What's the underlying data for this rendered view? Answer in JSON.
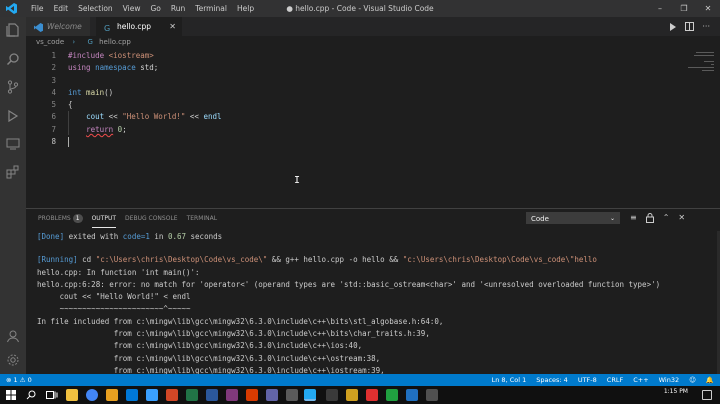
{
  "window": {
    "title": "● hello.cpp - Code - Visual Studio Code",
    "min": "–",
    "max": "❐",
    "close": "✕"
  },
  "menu": [
    "File",
    "Edit",
    "Selection",
    "View",
    "Go",
    "Run",
    "Terminal",
    "Help"
  ],
  "tabs": [
    {
      "label": "Welcome"
    },
    {
      "label": "hello.cpp",
      "close": "✕"
    }
  ],
  "breadcrumb": {
    "folder": "vs_code",
    "sep": "›",
    "icon": "C++ file-icon",
    "file": "hello.cpp"
  },
  "editor": {
    "line_numbers": [
      "1",
      "2",
      "3",
      "4",
      "5",
      "6",
      "7",
      "8"
    ],
    "code": {
      "l1_kw": "#include",
      "l1_hdr": " <iostream>",
      "l2_using": "using",
      "l2_ns": " namespace",
      "l2_std": " std;",
      "l4_int": "int",
      "l4_main": " main",
      "l4_paren": "()",
      "l5": "{",
      "l6_cout": "cout",
      "l6_op": " << ",
      "l6_str": "\"Hello World!\"",
      "l6_op2": " << ",
      "l6_endl": "endl",
      "l7_return": "return",
      "l7_num": " 0",
      "l7_semi": ";"
    },
    "current_line": "8"
  },
  "panel": {
    "tabs": {
      "problems": "PROBLEMS",
      "problems_count": "1",
      "output": "OUTPUT",
      "debug": "DEBUG CONSOLE",
      "terminal": "TERMINAL"
    },
    "channel": "Code",
    "output_lines": {
      "done_tag": "[Done]",
      "done_a": " exited with ",
      "done_code": "code=1",
      "done_b": " in ",
      "done_time": "0.67",
      "done_c": " seconds",
      "run_tag": "[Running]",
      "run_cmd_a": " cd ",
      "run_path1": "\"c:\\Users\\chris\\Desktop\\Code\\vs_code\\\"",
      "run_cmd_b": " && g++ hello.cpp -o hello && ",
      "run_path2": "\"c:\\Users\\chris\\Desktop\\Code\\vs_code\\\"hello",
      "l3": "hello.cpp: In function 'int main()':",
      "l4": "hello.cpp:6:28: error: no match for 'operator<' (operand types are 'std::basic_ostream<char>' and '<unresolved overloaded function type>')",
      "l5": "     cout << \"Hello World!\" < endl",
      "l6": "     ~~~~~~~~~~~~~~~~~~~~~~~^~~~~~",
      "l7": "In file included from c:\\mingw\\lib\\gcc\\mingw32\\6.3.0\\include\\c++\\bits\\stl_algobase.h:64:0,",
      "l8": "                 from c:\\mingw\\lib\\gcc\\mingw32\\6.3.0\\include\\c++\\bits\\char_traits.h:39,",
      "l9": "                 from c:\\mingw\\lib\\gcc\\mingw32\\6.3.0\\include\\c++\\ios:40,",
      "l10": "                 from c:\\mingw\\lib\\gcc\\mingw32\\6.3.0\\include\\c++\\ostream:38,",
      "l11": "                 from c:\\mingw\\lib\\gcc\\mingw32\\6.3.0\\include\\c++\\iostream:39,"
    }
  },
  "status": {
    "errors": "⊗ 1 ⚠ 0",
    "position": "Ln 8, Col 1",
    "spaces": "Spaces: 4",
    "encoding": "UTF-8",
    "eol": "CRLF",
    "language": "C++",
    "platform": "Win32",
    "feedback": "☺",
    "bell": "🔔"
  },
  "taskbar": {
    "time": "1:15 PM"
  },
  "colors": {
    "accent": "#007acc",
    "activity": "#333333",
    "editor_bg": "#1e1e1e"
  }
}
